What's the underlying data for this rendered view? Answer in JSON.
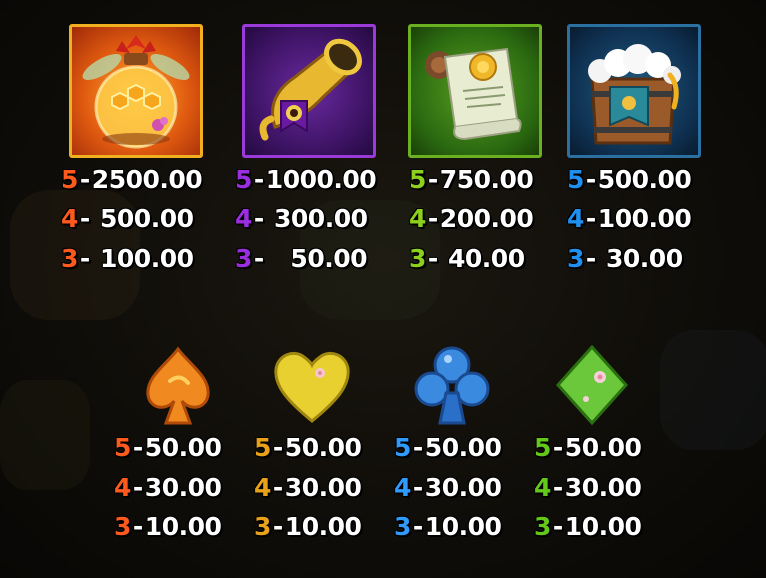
{
  "colors": {
    "orange": "#ff5a1e",
    "purple": "#9b2fe0",
    "green": "#8ccf1c",
    "blue": "#1f8ff0",
    "gold": "#e8a21a",
    "low_blue": "#2f9bff",
    "low_green": "#63c81a"
  },
  "high_symbols": [
    {
      "icon": "honey-potion-jar-icon",
      "pays": [
        {
          "count": "5",
          "value": "2500.00"
        },
        {
          "count": "4",
          "value": "500.00"
        },
        {
          "count": "3",
          "value": "100.00"
        }
      ]
    },
    {
      "icon": "golden-horn-icon",
      "pays": [
        {
          "count": "5",
          "value": "1000.00"
        },
        {
          "count": "4",
          "value": "300.00"
        },
        {
          "count": "3",
          "value": "50.00"
        }
      ]
    },
    {
      "icon": "sealed-scroll-icon",
      "pays": [
        {
          "count": "5",
          "value": "750.00"
        },
        {
          "count": "4",
          "value": "200.00"
        },
        {
          "count": "3",
          "value": "40.00"
        }
      ]
    },
    {
      "icon": "frothy-tankard-icon",
      "pays": [
        {
          "count": "5",
          "value": "500.00"
        },
        {
          "count": "4",
          "value": "100.00"
        },
        {
          "count": "3",
          "value": "30.00"
        }
      ]
    }
  ],
  "low_symbols": [
    {
      "icon": "orange-spade-icon",
      "pays": [
        {
          "count": "5",
          "value": "50.00"
        },
        {
          "count": "4",
          "value": "30.00"
        },
        {
          "count": "3",
          "value": "10.00"
        }
      ]
    },
    {
      "icon": "yellow-heart-icon",
      "pays": [
        {
          "count": "5",
          "value": "50.00"
        },
        {
          "count": "4",
          "value": "30.00"
        },
        {
          "count": "3",
          "value": "10.00"
        }
      ]
    },
    {
      "icon": "blue-club-icon",
      "pays": [
        {
          "count": "5",
          "value": "50.00"
        },
        {
          "count": "4",
          "value": "30.00"
        },
        {
          "count": "3",
          "value": "10.00"
        }
      ]
    },
    {
      "icon": "green-diamond-icon",
      "pays": [
        {
          "count": "5",
          "value": "50.00"
        },
        {
          "count": "4",
          "value": "30.00"
        },
        {
          "count": "3",
          "value": "10.00"
        }
      ]
    }
  ]
}
